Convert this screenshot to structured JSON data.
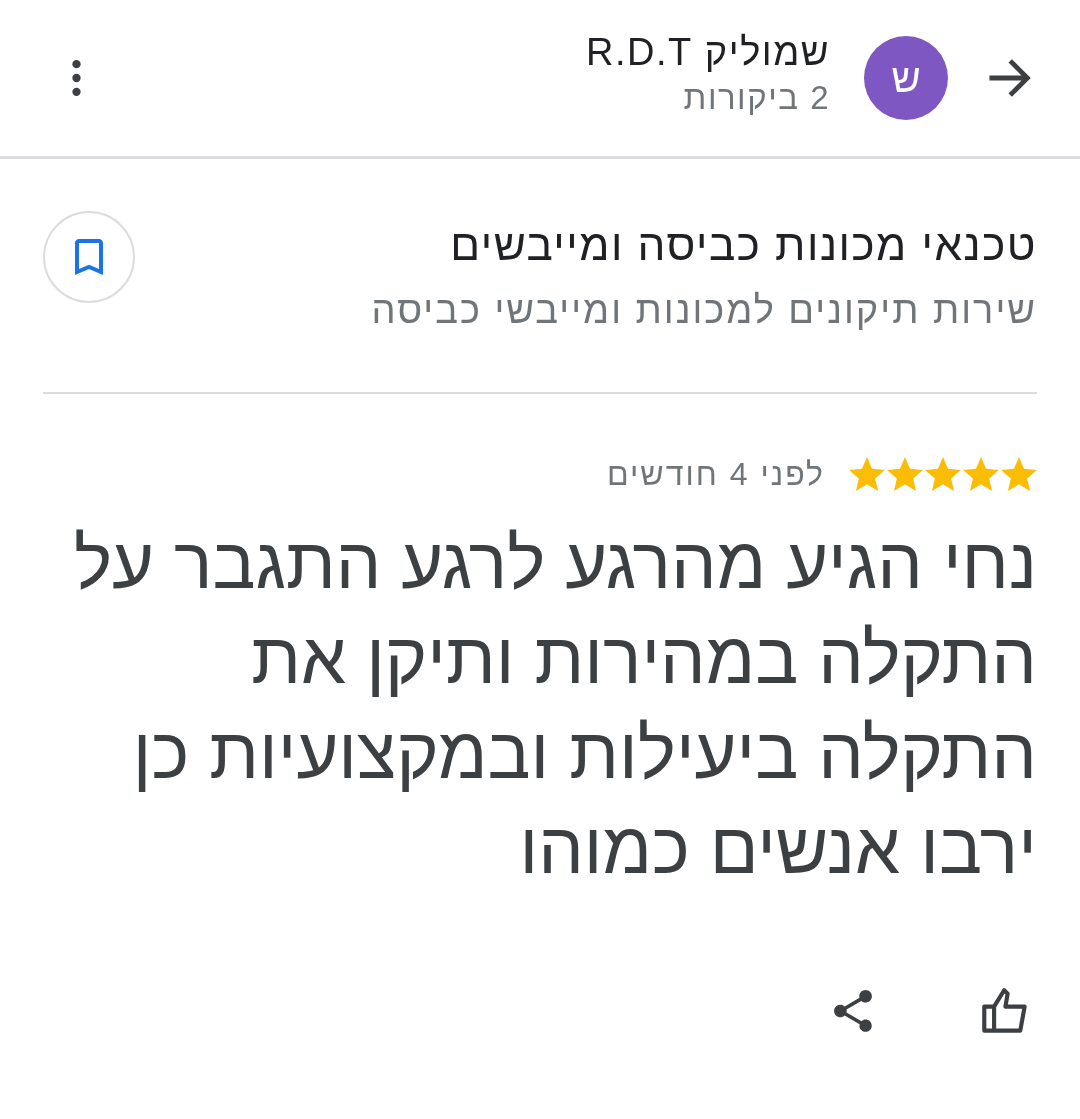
{
  "reviewer": {
    "avatar_letter": "ש",
    "name": "שמוליק R.D.T",
    "reviews_count": "2 ביקורות"
  },
  "place": {
    "name": "טכנאי מכונות כביסה ומייבשים",
    "category": "שירות תיקונים למכונות ומייבשי כביסה",
    "saved": false
  },
  "review": {
    "stars": 5,
    "time": "לפני 4 חודשים",
    "text": "נחי הגיע מהרגע לרגע התגבר על התקלה במהירות ותיקן את התקלה ביעילות ובמקצועיות כן ירבו אנשים כמוהו",
    "liked": false
  }
}
